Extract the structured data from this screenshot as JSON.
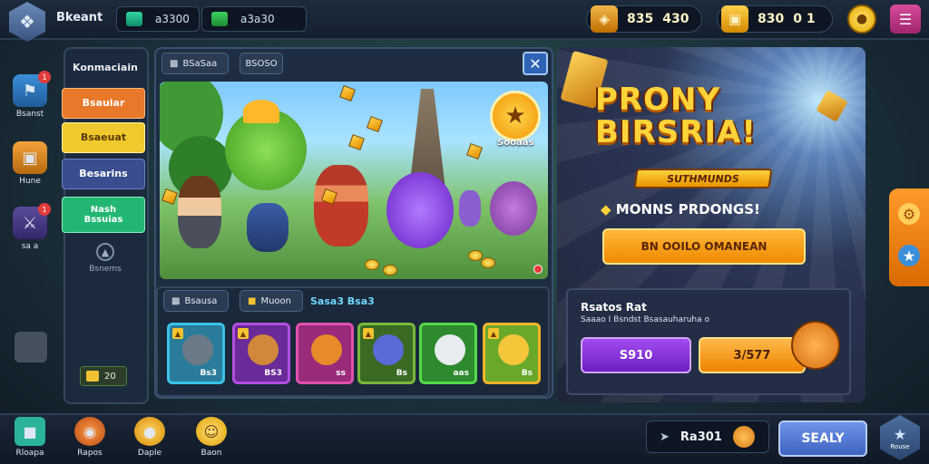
{
  "topbar": {
    "player_name": "Bkeant",
    "resource1": {
      "icon": "gem-icon",
      "value": "a3300"
    },
    "resource2": {
      "icon": "cash-icon",
      "value": "a3a30"
    },
    "pill1": {
      "a": "835",
      "b": "430"
    },
    "pill2": {
      "a": "830",
      "b": "0 1"
    }
  },
  "rail": [
    {
      "label": "Bsanst",
      "icon": "map-icon",
      "badge": "1"
    },
    {
      "label": "Hune",
      "icon": "chest-icon",
      "badge": ""
    },
    {
      "label": "sa a",
      "icon": "sword-icon",
      "badge": "1"
    }
  ],
  "menu": {
    "title": "Konmaciain",
    "items": [
      {
        "label": "Bsauiar",
        "color": "#e8792a"
      },
      {
        "label": "Bsaeuat",
        "color": "#f0c92e"
      },
      {
        "label": "Besarins",
        "color": "#3a4d8e"
      },
      {
        "label": "Nash\nBssuias",
        "color": "#22b673"
      }
    ],
    "locked_label": "Bsnems",
    "chip_value": "20"
  },
  "window": {
    "tab1": "BSaSaa",
    "tab2": "BSOSO",
    "badge_label": "Sooaas",
    "inv_tab1": "Bsausa",
    "inv_tab2": "Muoon",
    "inv_link": "Sasa3 Bsa3",
    "cards": [
      {
        "value": "Bs3",
        "border": "#38c3e6",
        "bg": "#2a7c9a",
        "creature": "#6b7a86"
      },
      {
        "value": "BS3",
        "border": "#b24fe0",
        "bg": "#6a2a98",
        "creature": "#d2883a"
      },
      {
        "value": "ss",
        "border": "#e050b0",
        "bg": "#9a2a7a",
        "creature": "#e88a2a"
      },
      {
        "value": "Bs",
        "border": "#7ab83a",
        "bg": "#3a6a24",
        "creature": "#5a6ad6"
      },
      {
        "value": "aas",
        "border": "#55d94a",
        "bg": "#2e8a2e",
        "creature": "#e7ecef"
      },
      {
        "value": "Bs",
        "border": "#f1b42a",
        "bg": "#6aa82a",
        "creature": "#f6c63a"
      }
    ]
  },
  "promo": {
    "title_line1": "PRONY",
    "title_line2": "BIRSRIA!",
    "subtitle": "SUTHMUNDS",
    "tagline": "MONNS PRDONGS!",
    "cta": "BN OOILO OMANEAN",
    "offer_title": "Rsatos Rat",
    "offer_desc": "Saaao I Bsndst Bsasauharuha o",
    "buy1": "S910",
    "buy2": "3/577"
  },
  "bottombar": {
    "items": [
      {
        "label": "Rloapa",
        "icon": "cube-icon",
        "color": "#2bb39a"
      },
      {
        "label": "Rapos",
        "icon": "orb-icon",
        "color": "#e0692a"
      },
      {
        "label": "Daple",
        "icon": "coin-icon",
        "color": "#f0b232"
      },
      {
        "label": "Baon",
        "icon": "smile-coin-icon",
        "color": "#f4c33a"
      }
    ],
    "pill_value": "Ra301",
    "sell_label": "SEALY",
    "star_label": "Rouse"
  }
}
